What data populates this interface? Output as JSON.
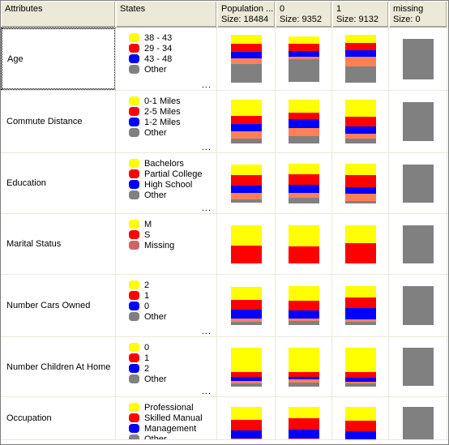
{
  "header": {
    "columns": [
      {
        "name": "attributes",
        "line1": "Attributes",
        "line2": "",
        "width": 142
      },
      {
        "name": "states",
        "line1": "States",
        "line2": "",
        "width": 125
      },
      {
        "name": "population",
        "line1": "Population ...",
        "line2": "Size: 18484",
        "width": 72
      },
      {
        "name": "state-0",
        "line1": "0",
        "line2": "Size: 9352",
        "width": 70
      },
      {
        "name": "state-1",
        "line1": "1",
        "line2": "Size: 9132",
        "width": 70
      },
      {
        "name": "missing",
        "line1": "missing",
        "line2": "Size: 0",
        "width": 72
      }
    ]
  },
  "palette": {
    "yellow": "#ffff00",
    "red": "#ff0000",
    "blue": "#0000ff",
    "orange": "#ff8055",
    "gray": "#808080",
    "rose": "#cc6666",
    "grid_line": "#ece9d8",
    "header_bg": "#ece9d8",
    "header_border": "#aca899",
    "cell_bg": "#ffffff"
  },
  "rows": [
    {
      "attribute": "Age",
      "height": 78,
      "focused": true,
      "legend": [
        {
          "color": "#ffff00",
          "label": "38 - 43"
        },
        {
          "color": "#ff0000",
          "label": "29 - 34"
        },
        {
          "color": "#0000ff",
          "label": "43 - 48"
        },
        {
          "color": "#808080",
          "label": "Other"
        }
      ],
      "legend_more": "...",
      "charts": [
        {
          "column": "population",
          "segments": [
            {
              "color": "#ffff00",
              "h": 11
            },
            {
              "color": "#ff0000",
              "h": 10
            },
            {
              "color": "#0000ff",
              "h": 8
            },
            {
              "color": "#ff8055",
              "h": 7
            },
            {
              "color": "#808080",
              "h": 23
            }
          ]
        },
        {
          "column": "state-0",
          "segments": [
            {
              "color": "#ffff00",
              "h": 9
            },
            {
              "color": "#ff0000",
              "h": 9
            },
            {
              "color": "#0000ff",
              "h": 7
            },
            {
              "color": "#ff8055",
              "h": 3
            },
            {
              "color": "#808080",
              "h": 28
            }
          ]
        },
        {
          "column": "state-1",
          "segments": [
            {
              "color": "#ffff00",
              "h": 10
            },
            {
              "color": "#ff0000",
              "h": 9
            },
            {
              "color": "#0000ff",
              "h": 8
            },
            {
              "color": "#ff8055",
              "h": 12
            },
            {
              "color": "#808080",
              "h": 20
            }
          ]
        },
        {
          "column": "missing",
          "segments": [
            {
              "color": "#808080",
              "h": 50
            }
          ]
        }
      ]
    },
    {
      "attribute": "Commute Distance",
      "height": 77,
      "focused": false,
      "legend": [
        {
          "color": "#ffff00",
          "label": "0-1 Miles"
        },
        {
          "color": "#ff0000",
          "label": "2-5 Miles"
        },
        {
          "color": "#0000ff",
          "label": "1-2 Miles"
        },
        {
          "color": "#808080",
          "label": "Other"
        }
      ],
      "legend_more": "...",
      "charts": [
        {
          "column": "population",
          "segments": [
            {
              "color": "#ffff00",
              "h": 20
            },
            {
              "color": "#ff0000",
              "h": 10
            },
            {
              "color": "#0000ff",
              "h": 9
            },
            {
              "color": "#ff8055",
              "h": 9
            },
            {
              "color": "#808080",
              "h": 6
            }
          ]
        },
        {
          "column": "state-0",
          "segments": [
            {
              "color": "#ffff00",
              "h": 16
            },
            {
              "color": "#ff0000",
              "h": 8
            },
            {
              "color": "#0000ff",
              "h": 11
            },
            {
              "color": "#ff8055",
              "h": 10
            },
            {
              "color": "#808080",
              "h": 9
            }
          ]
        },
        {
          "column": "state-1",
          "segments": [
            {
              "color": "#ffff00",
              "h": 21
            },
            {
              "color": "#ff0000",
              "h": 12
            },
            {
              "color": "#0000ff",
              "h": 9
            },
            {
              "color": "#ff8055",
              "h": 6
            },
            {
              "color": "#808080",
              "h": 6
            }
          ]
        },
        {
          "column": "missing",
          "segments": [
            {
              "color": "#808080",
              "h": 48
            }
          ]
        }
      ]
    },
    {
      "attribute": "Education",
      "height": 75,
      "focused": false,
      "legend": [
        {
          "color": "#ffff00",
          "label": "Bachelors"
        },
        {
          "color": "#ff0000",
          "label": "Partial College"
        },
        {
          "color": "#0000ff",
          "label": "High School"
        },
        {
          "color": "#808080",
          "label": "Other"
        }
      ],
      "legend_more": "...",
      "charts": [
        {
          "column": "population",
          "segments": [
            {
              "color": "#ffff00",
              "h": 13
            },
            {
              "color": "#ff0000",
              "h": 13
            },
            {
              "color": "#0000ff",
              "h": 9
            },
            {
              "color": "#ff8055",
              "h": 8
            },
            {
              "color": "#808080",
              "h": 4
            }
          ]
        },
        {
          "column": "state-0",
          "segments": [
            {
              "color": "#ffff00",
              "h": 13
            },
            {
              "color": "#ff0000",
              "h": 13
            },
            {
              "color": "#0000ff",
              "h": 10
            },
            {
              "color": "#ff8055",
              "h": 6
            },
            {
              "color": "#808080",
              "h": 7
            }
          ]
        },
        {
          "column": "state-1",
          "segments": [
            {
              "color": "#ffff00",
              "h": 14
            },
            {
              "color": "#ff0000",
              "h": 15
            },
            {
              "color": "#0000ff",
              "h": 8
            },
            {
              "color": "#ff8055",
              "h": 9
            },
            {
              "color": "#808080",
              "h": 3
            }
          ]
        },
        {
          "column": "missing",
          "segments": [
            {
              "color": "#808080",
              "h": 47
            }
          ]
        }
      ]
    },
    {
      "attribute": "Marital Status",
      "height": 75,
      "focused": false,
      "legend": [
        {
          "color": "#ffff00",
          "label": "M"
        },
        {
          "color": "#ff0000",
          "label": "S"
        },
        {
          "color": "#cc6666",
          "label": "Missing"
        }
      ],
      "legend_more": "",
      "charts": [
        {
          "column": "population",
          "segments": [
            {
              "color": "#ffff00",
              "h": 25
            },
            {
              "color": "#ff0000",
              "h": 22
            }
          ]
        },
        {
          "column": "state-0",
          "segments": [
            {
              "color": "#ffff00",
              "h": 26
            },
            {
              "color": "#ff0000",
              "h": 21
            }
          ]
        },
        {
          "column": "state-1",
          "segments": [
            {
              "color": "#ffff00",
              "h": 22
            },
            {
              "color": "#ff0000",
              "h": 25
            }
          ]
        },
        {
          "column": "missing",
          "segments": [
            {
              "color": "#808080",
              "h": 47
            }
          ]
        }
      ]
    },
    {
      "attribute": "Number Cars Owned",
      "height": 77,
      "focused": false,
      "legend": [
        {
          "color": "#ffff00",
          "label": "2"
        },
        {
          "color": "#ff0000",
          "label": "1"
        },
        {
          "color": "#0000ff",
          "label": "0"
        },
        {
          "color": "#808080",
          "label": "Other"
        }
      ],
      "legend_more": "...",
      "charts": [
        {
          "column": "population",
          "segments": [
            {
              "color": "#ffff00",
              "h": 16
            },
            {
              "color": "#ff0000",
              "h": 12
            },
            {
              "color": "#0000ff",
              "h": 11
            },
            {
              "color": "#ff8055",
              "h": 4
            },
            {
              "color": "#808080",
              "h": 4
            }
          ]
        },
        {
          "column": "state-0",
          "segments": [
            {
              "color": "#ffff00",
              "h": 18
            },
            {
              "color": "#ff0000",
              "h": 12
            },
            {
              "color": "#0000ff",
              "h": 10
            },
            {
              "color": "#ff8055",
              "h": 3
            },
            {
              "color": "#808080",
              "h": 5
            }
          ]
        },
        {
          "column": "state-1",
          "segments": [
            {
              "color": "#ffff00",
              "h": 14
            },
            {
              "color": "#ff0000",
              "h": 13
            },
            {
              "color": "#0000ff",
              "h": 14
            },
            {
              "color": "#ff8055",
              "h": 3
            },
            {
              "color": "#808080",
              "h": 4
            }
          ]
        },
        {
          "column": "missing",
          "segments": [
            {
              "color": "#808080",
              "h": 48
            }
          ]
        }
      ]
    },
    {
      "attribute": "Number Children At Home",
      "height": 74,
      "focused": false,
      "legend": [
        {
          "color": "#ffff00",
          "label": "0"
        },
        {
          "color": "#ff0000",
          "label": "1"
        },
        {
          "color": "#0000ff",
          "label": "2"
        },
        {
          "color": "#808080",
          "label": "Other"
        }
      ],
      "legend_more": "...",
      "charts": [
        {
          "column": "population",
          "segments": [
            {
              "color": "#ffff00",
              "h": 30
            },
            {
              "color": "#ff0000",
              "h": 6
            },
            {
              "color": "#0000ff",
              "h": 5
            },
            {
              "color": "#ff8055",
              "h": 3
            },
            {
              "color": "#808080",
              "h": 4
            }
          ]
        },
        {
          "column": "state-0",
          "segments": [
            {
              "color": "#ffff00",
              "h": 30
            },
            {
              "color": "#ff0000",
              "h": 6
            },
            {
              "color": "#0000ff",
              "h": 3
            },
            {
              "color": "#ff8055",
              "h": 4
            },
            {
              "color": "#808080",
              "h": 5
            }
          ]
        },
        {
          "column": "state-1",
          "segments": [
            {
              "color": "#ffff00",
              "h": 30
            },
            {
              "color": "#ff0000",
              "h": 7
            },
            {
              "color": "#0000ff",
              "h": 5
            },
            {
              "color": "#ff8055",
              "h": 2
            },
            {
              "color": "#808080",
              "h": 4
            }
          ]
        },
        {
          "column": "missing",
          "segments": [
            {
              "color": "#808080",
              "h": 47
            }
          ]
        }
      ]
    },
    {
      "attribute": "Occupation",
      "height": 53,
      "focused": false,
      "clipped": true,
      "legend": [
        {
          "color": "#ffff00",
          "label": "Professional"
        },
        {
          "color": "#ff0000",
          "label": "Skilled Manual"
        },
        {
          "color": "#0000ff",
          "label": "Management"
        },
        {
          "color": "#808080",
          "label": "Other"
        }
      ],
      "legend_more": "",
      "charts": [
        {
          "column": "population",
          "segments": [
            {
              "color": "#ffff00",
              "h": 16
            },
            {
              "color": "#ff0000",
              "h": 13
            },
            {
              "color": "#0000ff",
              "h": 10
            },
            {
              "color": "#ff8055",
              "h": 10
            }
          ]
        },
        {
          "column": "state-0",
          "segments": [
            {
              "color": "#ffff00",
              "h": 14
            },
            {
              "color": "#ff0000",
              "h": 14
            },
            {
              "color": "#0000ff",
              "h": 11
            },
            {
              "color": "#ff8055",
              "h": 10
            }
          ]
        },
        {
          "column": "state-1",
          "segments": [
            {
              "color": "#ffff00",
              "h": 17
            },
            {
              "color": "#ff0000",
              "h": 13
            },
            {
              "color": "#0000ff",
              "h": 10
            },
            {
              "color": "#ff8055",
              "h": 9
            }
          ]
        },
        {
          "column": "missing",
          "segments": [
            {
              "color": "#808080",
              "h": 40
            }
          ]
        }
      ]
    }
  ]
}
